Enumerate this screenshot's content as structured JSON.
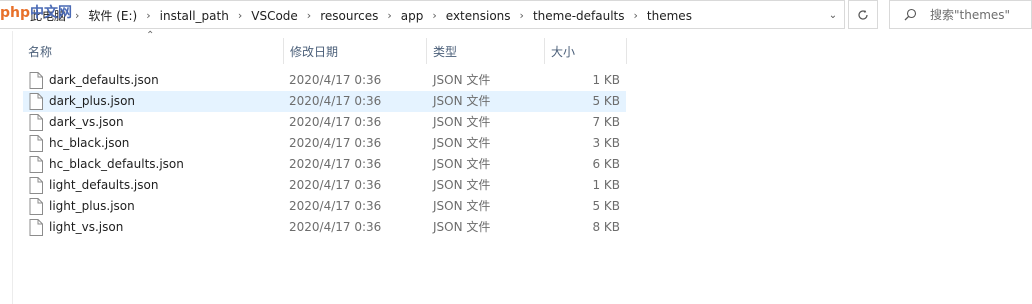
{
  "address": {
    "crumbs": [
      "此电脑",
      "软件 (E:)",
      "install_path",
      "VSCode",
      "resources",
      "app",
      "extensions",
      "theme-defaults",
      "themes"
    ]
  },
  "watermark": "php中文网",
  "search": {
    "placeholder": "搜索\"themes\""
  },
  "columns": {
    "name": "名称",
    "date": "修改日期",
    "type": "类型",
    "size": "大小"
  },
  "files": [
    {
      "name": "dark_defaults.json",
      "date": "2020/4/17 0:36",
      "type": "JSON 文件",
      "size": "1 KB",
      "selected": false
    },
    {
      "name": "dark_plus.json",
      "date": "2020/4/17 0:36",
      "type": "JSON 文件",
      "size": "5 KB",
      "selected": true
    },
    {
      "name": "dark_vs.json",
      "date": "2020/4/17 0:36",
      "type": "JSON 文件",
      "size": "7 KB",
      "selected": false
    },
    {
      "name": "hc_black.json",
      "date": "2020/4/17 0:36",
      "type": "JSON 文件",
      "size": "3 KB",
      "selected": false
    },
    {
      "name": "hc_black_defaults.json",
      "date": "2020/4/17 0:36",
      "type": "JSON 文件",
      "size": "6 KB",
      "selected": false
    },
    {
      "name": "light_defaults.json",
      "date": "2020/4/17 0:36",
      "type": "JSON 文件",
      "size": "1 KB",
      "selected": false
    },
    {
      "name": "light_plus.json",
      "date": "2020/4/17 0:36",
      "type": "JSON 文件",
      "size": "5 KB",
      "selected": false
    },
    {
      "name": "light_vs.json",
      "date": "2020/4/17 0:36",
      "type": "JSON 文件",
      "size": "8 KB",
      "selected": false
    }
  ],
  "colors": {
    "selection": "#e5f3ff",
    "header_text": "#4c607a"
  }
}
